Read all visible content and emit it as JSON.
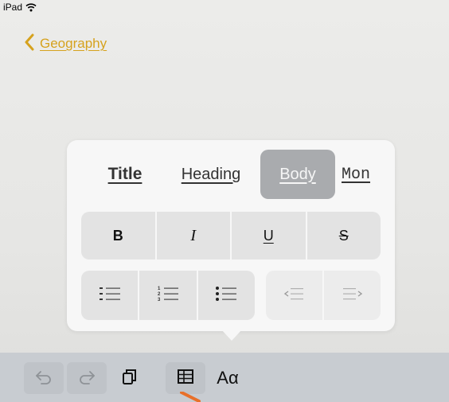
{
  "status_bar": {
    "device": "iPad",
    "wifi_icon": "wifi-icon"
  },
  "nav": {
    "back_label": "Geography",
    "back_icon": "chevron-left-icon",
    "accent_color": "#d6a21e"
  },
  "format_popover": {
    "paragraph_styles": [
      {
        "label": "Title",
        "selected": false
      },
      {
        "label": "Heading",
        "selected": false
      },
      {
        "label": "Body",
        "selected": true
      },
      {
        "label": "Mon",
        "selected": false
      }
    ],
    "text_formats": [
      {
        "label": "B",
        "name": "bold"
      },
      {
        "label": "I",
        "name": "italic"
      },
      {
        "label": "U",
        "name": "underline"
      },
      {
        "label": "S",
        "name": "strikethrough"
      }
    ],
    "list_buttons": [
      {
        "icon": "dashed-list-icon"
      },
      {
        "icon": "numbered-list-icon"
      },
      {
        "icon": "bulleted-list-icon"
      }
    ],
    "indent_buttons": [
      {
        "icon": "decrease-indent-icon",
        "enabled": false
      },
      {
        "icon": "increase-indent-icon",
        "enabled": false
      }
    ]
  },
  "toolbar": {
    "undo_icon": "undo-icon",
    "redo_icon": "redo-icon",
    "copy_icon": "copy-icon",
    "table_icon": "table-icon",
    "format_label": "Aα"
  }
}
